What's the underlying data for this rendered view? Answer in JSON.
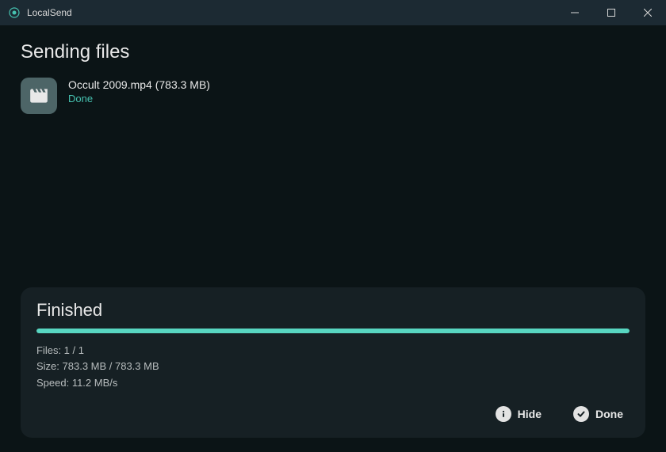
{
  "window": {
    "title": "LocalSend"
  },
  "header": {
    "title": "Sending files"
  },
  "files": [
    {
      "name": "Occult 2009.mp4 (783.3 MB)",
      "status": "Done",
      "icon": "movie"
    }
  ],
  "summary": {
    "title": "Finished",
    "progress_percent": 100,
    "stats": {
      "files": "Files: 1 / 1",
      "size": "Size: 783.3 MB / 783.3 MB",
      "speed": "Speed: 11.2 MB/s"
    },
    "actions": {
      "hide_label": "Hide",
      "done_label": "Done"
    }
  },
  "colors": {
    "accent": "#58d6c1",
    "status_text": "#46c2b0"
  }
}
